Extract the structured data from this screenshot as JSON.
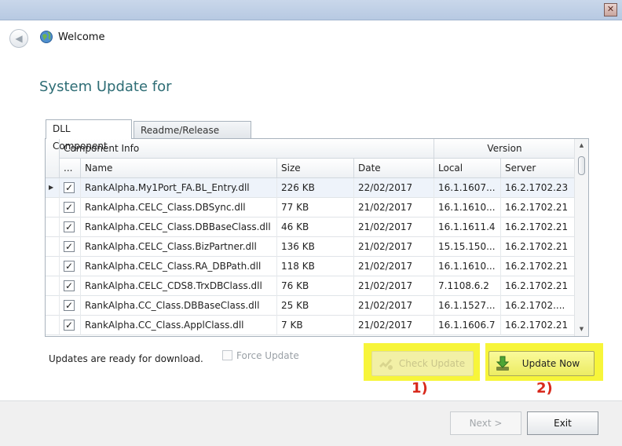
{
  "window": {
    "close_label": "✕"
  },
  "nav": {
    "back_icon": "◀",
    "title": "Welcome"
  },
  "heading": "System Update for",
  "tabs": [
    "DLL Component",
    "Readme/Release Note"
  ],
  "grid": {
    "group_headers": {
      "component_info": "Component Info",
      "version": "Version"
    },
    "columns": {
      "check": "...",
      "name": "Name",
      "size": "Size",
      "date": "Date",
      "local": "Local",
      "server": "Server"
    },
    "rows": [
      {
        "name": "RankAlpha.My1Port_FA.BL_Entry.dll",
        "size": "226 KB",
        "date": "22/02/2017",
        "local": "16.1.1607...",
        "server": "16.2.1702.23"
      },
      {
        "name": "RankAlpha.CELC_Class.DBSync.dll",
        "size": "77 KB",
        "date": "21/02/2017",
        "local": "16.1.1610...",
        "server": "16.2.1702.21"
      },
      {
        "name": "RankAlpha.CELC_Class.DBBaseClass.dll",
        "size": "46 KB",
        "date": "21/02/2017",
        "local": "16.1.1611.4",
        "server": "16.2.1702.21"
      },
      {
        "name": "RankAlpha.CELC_Class.BizPartner.dll",
        "size": "136 KB",
        "date": "21/02/2017",
        "local": "15.15.150...",
        "server": "16.2.1702.21"
      },
      {
        "name": "RankAlpha.CELC_Class.RA_DBPath.dll",
        "size": "118 KB",
        "date": "21/02/2017",
        "local": "16.1.1610...",
        "server": "16.2.1702.21"
      },
      {
        "name": "RankAlpha.CELC_CDS8.TrxDBClass.dll",
        "size": "76 KB",
        "date": "21/02/2017",
        "local": "7.1108.6.2",
        "server": "16.2.1702.21"
      },
      {
        "name": "RankAlpha.CC_Class.DBBaseClass.dll",
        "size": "25 KB",
        "date": "21/02/2017",
        "local": "16.1.1527...",
        "server": "16.2.1702...."
      },
      {
        "name": "RankAlpha.CC_Class.ApplClass.dll",
        "size": "7 KB",
        "date": "21/02/2017",
        "local": "16.1.1606.7",
        "server": "16.2.1702.21"
      }
    ],
    "row_indicator": "▶",
    "check_mark": "✓"
  },
  "status_text": "Updates are ready for download.",
  "force_update_label": "Force Update",
  "buttons": {
    "check_update": "Check Update",
    "update_now": "Update Now",
    "next": "Next >",
    "exit": "Exit"
  },
  "annotations": {
    "mark1": "1)",
    "mark2": "2)"
  },
  "colors": {
    "highlight": "#f7f53a",
    "annotation": "#d8291c",
    "heading": "#2e6d75"
  }
}
